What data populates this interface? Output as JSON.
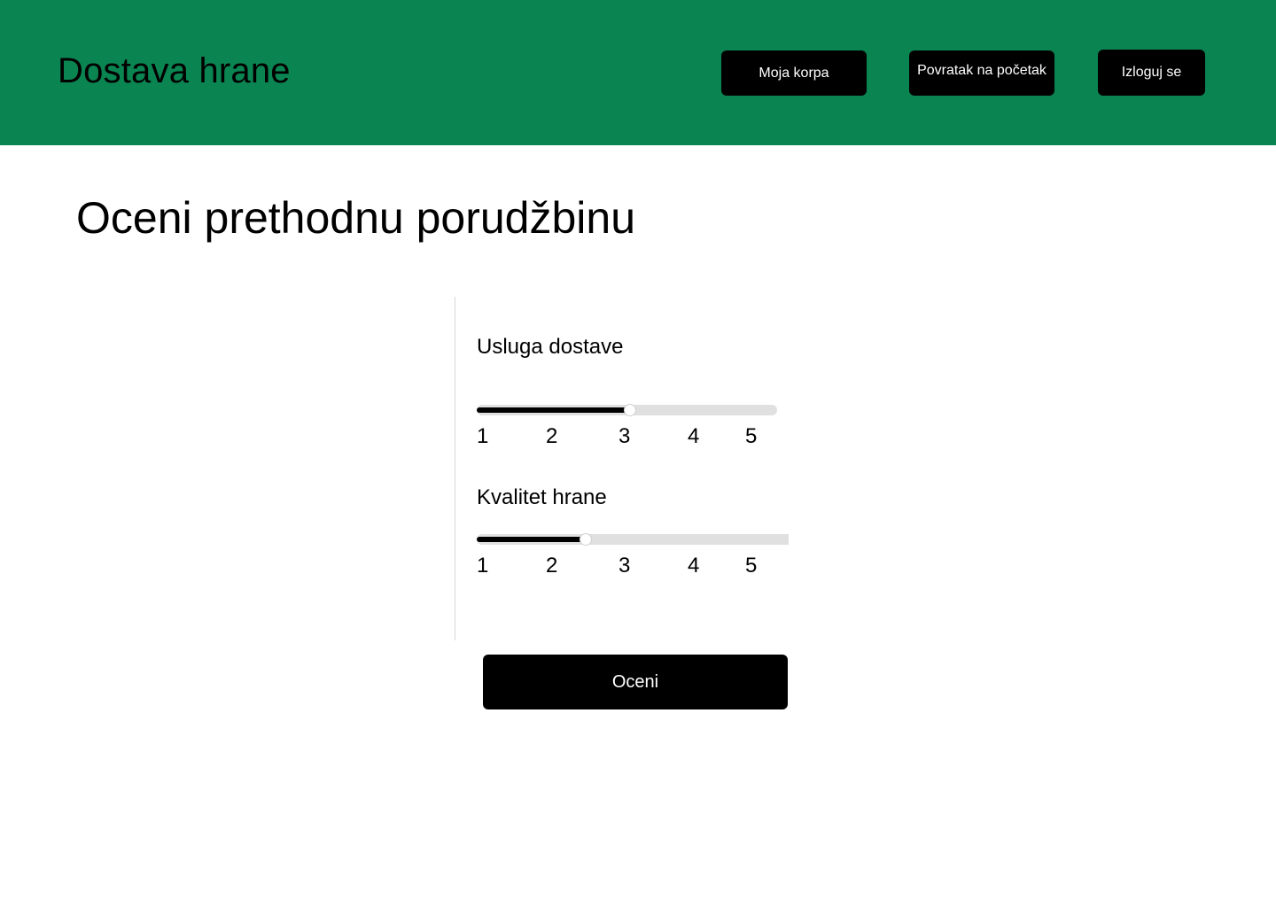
{
  "header": {
    "app_title": "Dostava hrane",
    "nav": {
      "cart_label": "Moja korpa",
      "home_label": "Povratak na početak",
      "logout_label": "Izloguj se"
    },
    "background_color": "#0a8552"
  },
  "main": {
    "page_title": "Oceni prethodnu porudžbinu",
    "ratings": [
      {
        "label": "Usluga dostave",
        "min": 1,
        "max": 5,
        "value": 3,
        "ticks": [
          "1",
          "2",
          "3",
          "4",
          "5"
        ]
      },
      {
        "label": "Kvalitet hrane",
        "min": 1,
        "max": 5,
        "value": 2.4,
        "ticks": [
          "1",
          "2",
          "3",
          "4",
          "5"
        ]
      }
    ],
    "submit_label": "Oceni"
  }
}
